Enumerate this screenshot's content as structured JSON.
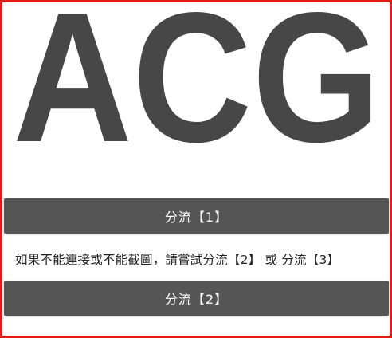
{
  "logo": {
    "text": "ACG",
    "color": "#474747"
  },
  "buttons": {
    "mirror1": "分流【1】",
    "mirror2": "分流【2】"
  },
  "notice": {
    "prefix": "如果不能連接或不能截圖，請嘗試",
    "link2": "分流【2】",
    "separator": " 或 ",
    "link3": "分流【3】"
  },
  "colors": {
    "frame_border": "#e01b1b",
    "button_bg": "#555555",
    "button_text": "#ffffff",
    "logo": "#474747"
  }
}
